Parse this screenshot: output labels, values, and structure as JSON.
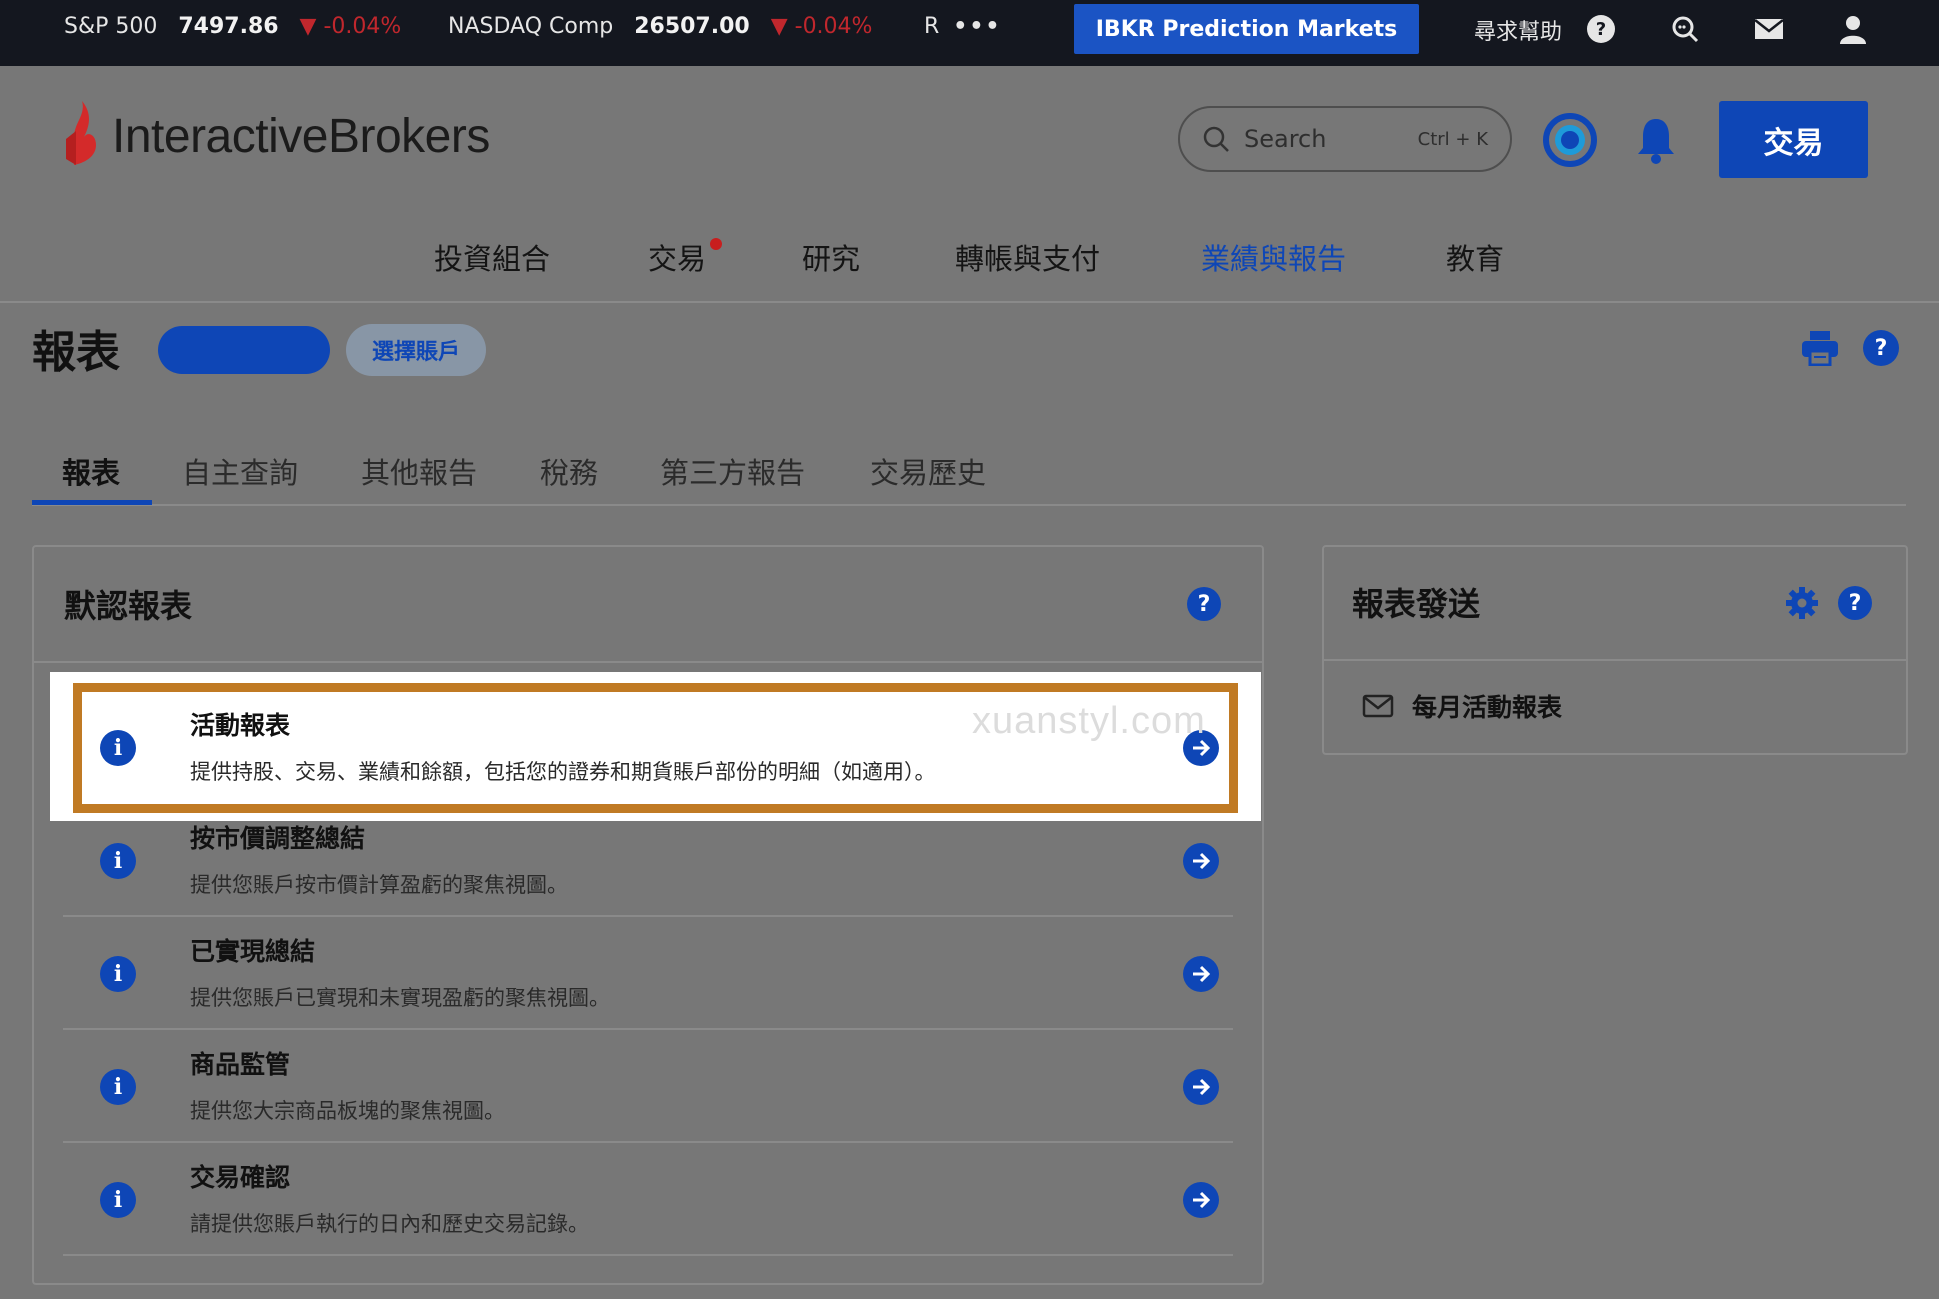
{
  "ticker": {
    "items": [
      {
        "name": "S&P 500",
        "value": "7497.86",
        "change": "-0.04%"
      },
      {
        "name": "NASDAQ Comp",
        "value": "26507.00",
        "change": "-0.04%"
      }
    ],
    "more_label": "R",
    "prediction_markets_label": "IBKR Prediction Markets",
    "help_label": "尋求幫助"
  },
  "header": {
    "logo_text": "InteractiveBrokers",
    "search_placeholder": "Search",
    "search_shortcut": "Ctrl + K",
    "trade_label": "交易"
  },
  "nav": {
    "items": [
      "投資組合",
      "交易",
      "研究",
      "轉帳與支付",
      "業績與報告",
      "教育"
    ],
    "active_index": 4
  },
  "page": {
    "title": "報表",
    "select_account_label": "選擇賬戶"
  },
  "tabs": {
    "items": [
      "報表",
      "自主查詢",
      "其他報告",
      "稅務",
      "第三方報告",
      "交易歷史"
    ],
    "active_index": 0
  },
  "default_reports": {
    "title": "默認報表",
    "rows": [
      {
        "title": "活動報表",
        "desc": "提供持股、交易、業績和餘額，包括您的證券和期貨賬戶部份的明細（如適用）。"
      },
      {
        "title": "按市價調整總結",
        "desc": "提供您賬戶按市價計算盈虧的聚焦視圖。"
      },
      {
        "title": "已實現總結",
        "desc": "提供您賬戶已實現和未實現盈虧的聚焦視圖。"
      },
      {
        "title": "商品監管",
        "desc": "提供您大宗商品板塊的聚焦視圖。"
      },
      {
        "title": "交易確認",
        "desc": "請提供您賬戶執行的日內和歷史交易記錄。"
      }
    ],
    "highlighted_index": 0
  },
  "delivery": {
    "title": "報表發送",
    "items": [
      "每月活動報表"
    ]
  },
  "watermark": "xuanstyl.com",
  "colors": {
    "accent": "#0e46b6",
    "highlight_frame": "#c07a24",
    "down": "#c0272d",
    "ticker_bg": "#14171f"
  }
}
